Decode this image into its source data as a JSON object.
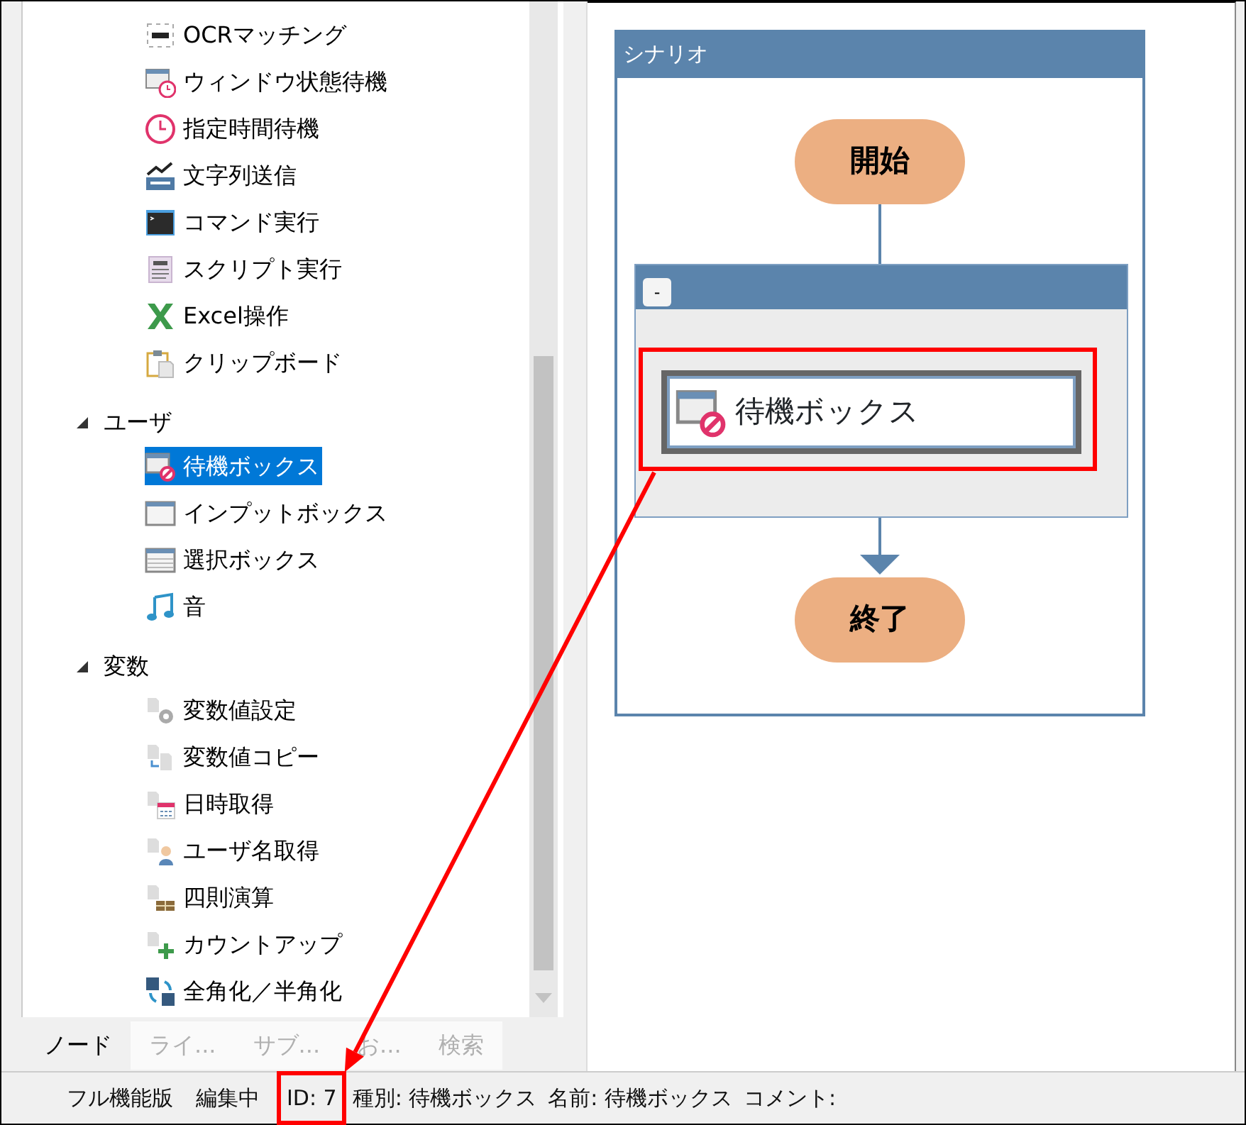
{
  "tree": [
    {
      "children": [
        {
          "label": "OCRマッチング",
          "kind": "ocr",
          "selected": false
        },
        {
          "label": "ウィンドウ状態待機",
          "kind": "window-clock",
          "selected": false
        },
        {
          "label": "指定時間待機",
          "kind": "clock",
          "selected": false
        },
        {
          "label": "文字列送信",
          "kind": "text-send",
          "selected": false
        },
        {
          "label": "コマンド実行",
          "kind": "terminal",
          "selected": false
        },
        {
          "label": "スクリプト実行",
          "kind": "script",
          "selected": false
        },
        {
          "label": "Excel操作",
          "kind": "excel",
          "selected": false
        },
        {
          "label": "クリップボード",
          "kind": "clipboard",
          "selected": false
        }
      ]
    },
    {
      "label": "ユーザ",
      "expanded": true,
      "children": [
        {
          "label": "待機ボックス",
          "kind": "window-block",
          "selected": true
        },
        {
          "label": "インプットボックス",
          "kind": "window",
          "selected": false
        },
        {
          "label": "選択ボックス",
          "kind": "list-window",
          "selected": false
        },
        {
          "label": "音",
          "kind": "music",
          "selected": false
        }
      ]
    },
    {
      "label": "変数",
      "expanded": true,
      "children": [
        {
          "label": "変数値設定",
          "kind": "var-gear",
          "selected": false
        },
        {
          "label": "変数値コピー",
          "kind": "var-copy",
          "selected": false
        },
        {
          "label": "日時取得",
          "kind": "var-calendar",
          "selected": false
        },
        {
          "label": "ユーザ名取得",
          "kind": "var-user",
          "selected": false
        },
        {
          "label": "四則演算",
          "kind": "var-calc",
          "selected": false
        },
        {
          "label": "カウントアップ",
          "kind": "var-plus",
          "selected": false
        },
        {
          "label": "全角化／半角化",
          "kind": "convert",
          "selected": false
        }
      ]
    }
  ],
  "tabs": [
    {
      "label": "ノード",
      "selected": true
    },
    {
      "label": "ライ...",
      "selected": false
    },
    {
      "label": "サブ...",
      "selected": false
    },
    {
      "label": "お...",
      "selected": false
    },
    {
      "label": "検索",
      "selected": false
    }
  ],
  "flowchart": {
    "title": "シナリオ",
    "start": "開始",
    "group": {
      "collapse_button": "-",
      "expanded": true,
      "nodes": [
        {
          "label": "待機ボックス",
          "kind": "window-block",
          "highlighted": true
        }
      ]
    },
    "end": "終了"
  },
  "status_bar": [
    {
      "text": "フル機能版",
      "highlighted": false
    },
    {
      "text": "編集中",
      "highlighted": false
    },
    {
      "text": "ID: 7",
      "highlighted": true
    },
    {
      "text": "種別: 待機ボックス",
      "highlighted": false
    },
    {
      "text": "名前: 待機ボックス",
      "highlighted": false
    },
    {
      "text": "コメント:",
      "highlighted": false
    }
  ]
}
